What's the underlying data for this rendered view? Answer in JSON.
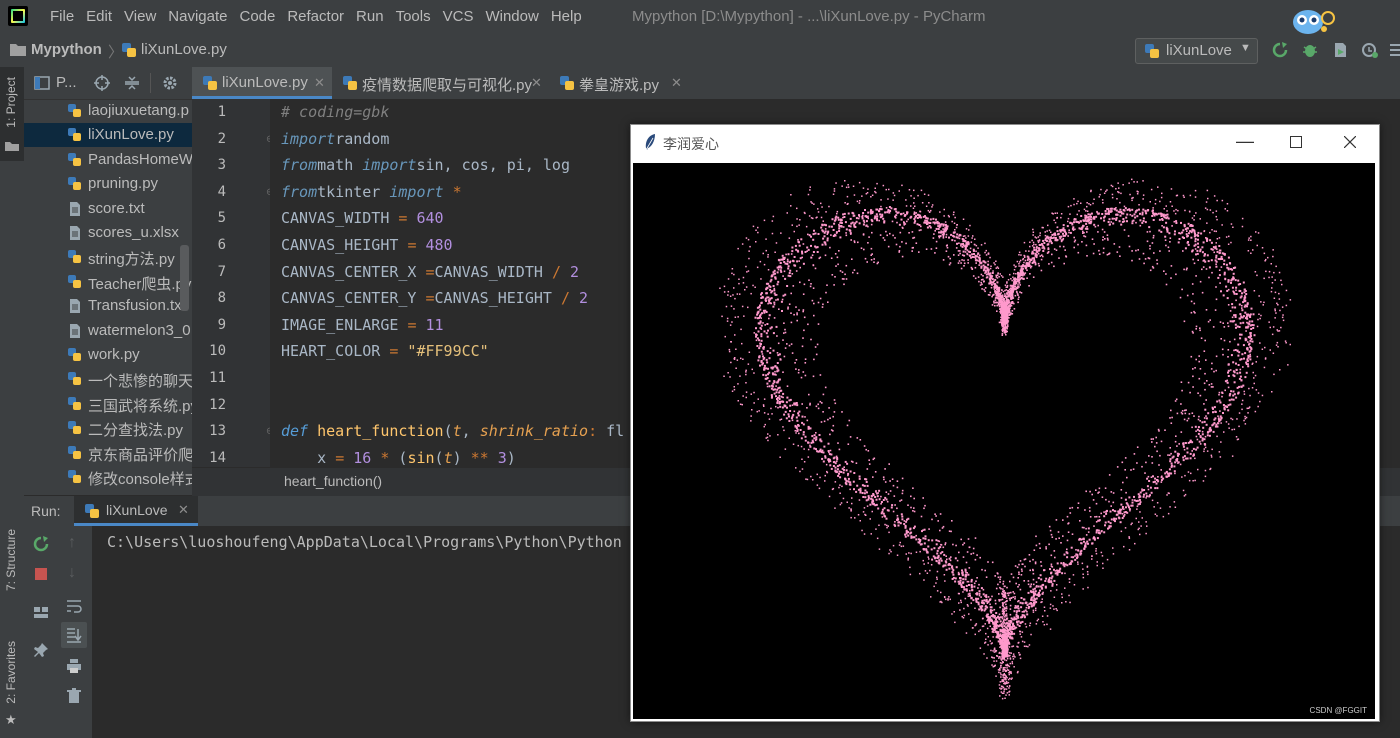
{
  "menu": {
    "items": [
      "File",
      "Edit",
      "View",
      "Navigate",
      "Code",
      "Refactor",
      "Run",
      "Tools",
      "VCS",
      "Window",
      "Help"
    ],
    "window_title": "Mypython [D:\\Mypython] - ...\\liXunLove.py - PyCharm"
  },
  "navbar": {
    "project": "Mypython",
    "file": "liXunLove.py",
    "run_config": "liXunLove"
  },
  "left_stripe": {
    "project_tab": "1: Project",
    "structure_tab": "7: Structure",
    "favorites_tab": "2: Favorites"
  },
  "project_panel": {
    "title": "P...",
    "files": [
      {
        "label": "laojiuxuetang.p",
        "type": "py"
      },
      {
        "label": "liXunLove.py",
        "type": "py",
        "selected": true
      },
      {
        "label": "PandasHomeW",
        "type": "py"
      },
      {
        "label": "pruning.py",
        "type": "py"
      },
      {
        "label": "score.txt",
        "type": "txt"
      },
      {
        "label": "scores_u.xlsx",
        "type": "xlsx"
      },
      {
        "label": "string方法.py",
        "type": "py"
      },
      {
        "label": "Teacher爬虫.py",
        "type": "py"
      },
      {
        "label": "Transfusion.txt",
        "type": "txt"
      },
      {
        "label": "watermelon3_0",
        "type": "txt"
      },
      {
        "label": "work.py",
        "type": "py"
      },
      {
        "label": "一个悲惨的聊天记",
        "type": "py"
      },
      {
        "label": "三国武将系统.py",
        "type": "py"
      },
      {
        "label": "二分查找法.py",
        "type": "py"
      },
      {
        "label": "京东商品评价爬虫",
        "type": "py"
      },
      {
        "label": "修改console样式",
        "type": "py"
      }
    ]
  },
  "editor_tabs": [
    {
      "label": "liXunLove.py",
      "active": true
    },
    {
      "label": "疫情数据爬取与可视化.py",
      "active": false
    },
    {
      "label": "拳皇游戏.py",
      "active": false
    }
  ],
  "editor": {
    "line_numbers": [
      "1",
      "2",
      "3",
      "4",
      "5",
      "6",
      "7",
      "8",
      "9",
      "10",
      "11",
      "12",
      "13",
      "14"
    ],
    "lines": [
      [
        [
          "cm",
          "# coding=gbk"
        ]
      ],
      [
        [
          "kw",
          "import"
        ],
        [
          "",
          "random"
        ]
      ],
      [
        [
          "kw",
          "from"
        ],
        [
          "",
          "math "
        ],
        [
          "kw",
          "import"
        ],
        [
          "",
          "sin, cos, pi, log"
        ]
      ],
      [
        [
          "kw",
          "from"
        ],
        [
          "",
          "tkinter "
        ],
        [
          "kw",
          "import"
        ],
        [
          "op",
          " *"
        ]
      ],
      [
        [
          "",
          "CANVAS_WIDTH "
        ],
        [
          "op",
          "="
        ],
        [
          "num",
          " 640"
        ]
      ],
      [
        [
          "",
          "CANVAS_HEIGHT "
        ],
        [
          "op",
          "="
        ],
        [
          "num",
          " 480"
        ]
      ],
      [
        [
          "",
          "CANVAS_CENTER_X "
        ],
        [
          "op",
          "="
        ],
        [
          "",
          "CANVAS_WIDTH "
        ],
        [
          "op",
          "/"
        ],
        [
          "num",
          " 2"
        ]
      ],
      [
        [
          "",
          "CANVAS_CENTER_Y "
        ],
        [
          "op",
          "="
        ],
        [
          "",
          "CANVAS_HEIGHT "
        ],
        [
          "op",
          "/"
        ],
        [
          "num",
          " 2"
        ]
      ],
      [
        [
          "",
          "IMAGE_ENLARGE "
        ],
        [
          "op",
          "="
        ],
        [
          "num",
          " 11"
        ]
      ],
      [
        [
          "",
          "HEART_COLOR "
        ],
        [
          "op",
          "="
        ],
        [
          "str",
          " \"#FF99CC\""
        ]
      ],
      [],
      [],
      [
        [
          "kw2",
          "def"
        ],
        [
          "fn",
          " heart_function"
        ],
        [
          "",
          "("
        ],
        [
          "param",
          "t"
        ],
        [
          "",
          ", "
        ],
        [
          "param",
          "shrink_ratio"
        ],
        [
          "op",
          ": "
        ],
        [
          "",
          "fl"
        ]
      ],
      [
        [
          "",
          "    x "
        ],
        [
          "op",
          "="
        ],
        [
          "num",
          " 16 "
        ],
        [
          "op",
          "*"
        ],
        [
          "",
          " ("
        ],
        [
          "fn",
          "sin"
        ],
        [
          "",
          "("
        ],
        [
          "param",
          "t"
        ],
        [
          "",
          ") "
        ],
        [
          "op",
          "**"
        ],
        [
          "num",
          " 3"
        ],
        [
          "",
          ")"
        ]
      ]
    ],
    "breadcrumb": "heart_function()"
  },
  "run_panel": {
    "label": "Run:",
    "tab": "liXunLove",
    "console_line": "C:\\Users\\luoshoufeng\\AppData\\Local\\Programs\\Python\\Python"
  },
  "tk_window": {
    "title": "李润爱心",
    "heart_color": "#FF99CC",
    "canvas_background": "#000000"
  },
  "watermark": "CSDN @FGGIT",
  "colors": {
    "menu_bg": "#3c3f41",
    "editor_bg": "#2b2b2b",
    "selection": "#0d293e"
  }
}
